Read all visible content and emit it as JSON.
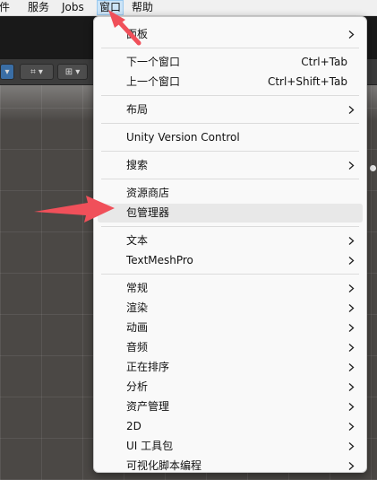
{
  "menubar": {
    "items": [
      {
        "label": "组件",
        "active": false
      },
      {
        "label": "服务",
        "active": false
      },
      {
        "label": "Jobs",
        "active": false
      },
      {
        "label": "窗口",
        "active": true
      },
      {
        "label": "帮助",
        "active": false
      }
    ]
  },
  "dropdown": {
    "items": [
      {
        "label": "面板",
        "shortcut": "",
        "submenu": true,
        "highlighted": false
      },
      {
        "label": "下一个窗口",
        "shortcut": "Ctrl+Tab",
        "submenu": false,
        "highlighted": false
      },
      {
        "label": "上一个窗口",
        "shortcut": "Ctrl+Shift+Tab",
        "submenu": false,
        "highlighted": false
      },
      {
        "label": "布局",
        "shortcut": "",
        "submenu": true,
        "highlighted": false
      },
      {
        "label": "Unity Version Control",
        "shortcut": "",
        "submenu": false,
        "highlighted": false
      },
      {
        "label": "搜索",
        "shortcut": "",
        "submenu": true,
        "highlighted": false
      },
      {
        "label": "资源商店",
        "shortcut": "",
        "submenu": false,
        "highlighted": false
      },
      {
        "label": "包管理器",
        "shortcut": "",
        "submenu": false,
        "highlighted": true
      },
      {
        "label": "文本",
        "shortcut": "",
        "submenu": true,
        "highlighted": false
      },
      {
        "label": "TextMeshPro",
        "shortcut": "",
        "submenu": true,
        "highlighted": false
      },
      {
        "label": "常规",
        "shortcut": "",
        "submenu": true,
        "highlighted": false
      },
      {
        "label": "渲染",
        "shortcut": "",
        "submenu": true,
        "highlighted": false
      },
      {
        "label": "动画",
        "shortcut": "",
        "submenu": true,
        "highlighted": false
      },
      {
        "label": "音频",
        "shortcut": "",
        "submenu": true,
        "highlighted": false
      },
      {
        "label": "正在排序",
        "shortcut": "",
        "submenu": true,
        "highlighted": false
      },
      {
        "label": "分析",
        "shortcut": "",
        "submenu": true,
        "highlighted": false
      },
      {
        "label": "资产管理",
        "shortcut": "",
        "submenu": true,
        "highlighted": false
      },
      {
        "label": "2D",
        "shortcut": "",
        "submenu": true,
        "highlighted": false
      },
      {
        "label": "UI 工具包",
        "shortcut": "",
        "submenu": true,
        "highlighted": false
      },
      {
        "label": "可视化脚本编程",
        "shortcut": "",
        "submenu": true,
        "highlighted": false
      }
    ]
  },
  "annotations": {
    "color": "#f0505a",
    "icons": [
      "arrow-to-window-menu",
      "arrow-to-package-manager"
    ]
  },
  "icons": {
    "submenu": "chevron-right-icon"
  }
}
